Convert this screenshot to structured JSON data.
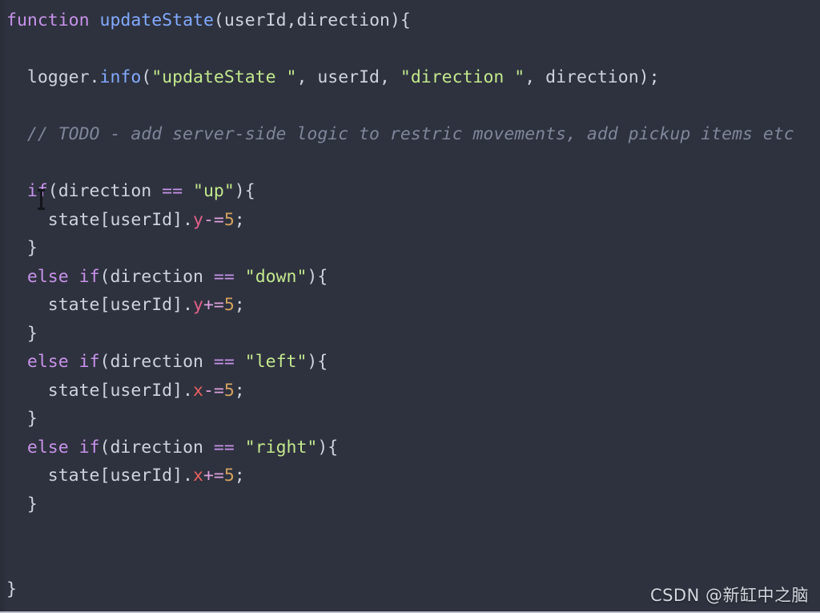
{
  "editor": {
    "background_color": "#2e323e",
    "font_size_px": 21.5,
    "theme_name": "dark",
    "language": "javascript"
  },
  "colors": {
    "background": "#2e323e",
    "gutter_edge": "#2a2e39",
    "keyword": "#c792ea",
    "function_name": "#82aaff",
    "string": "#c3e88d",
    "plain_text": "#cdd2dd",
    "comment": "#7f869a",
    "property_y": "#e25f8a",
    "property_x": "#e8605f",
    "operator": "#dda0dd",
    "number": "#d4a15f",
    "watermark": "#d3d7de",
    "mouse_caret": "#14161c"
  },
  "code": {
    "lines": [
      {
        "index": 1,
        "tokens": [
          {
            "text": "function",
            "kind": "keyword"
          },
          {
            "text": " ",
            "kind": "plain"
          },
          {
            "text": "updateState",
            "kind": "function_name"
          },
          {
            "text": "(userId,direction){",
            "kind": "plain"
          }
        ]
      },
      {
        "index": 2,
        "tokens": []
      },
      {
        "index": 3,
        "tokens": [
          {
            "text": "  logger.",
            "kind": "plain"
          },
          {
            "text": "info",
            "kind": "function_name"
          },
          {
            "text": "(",
            "kind": "plain"
          },
          {
            "text": "\"updateState \"",
            "kind": "string"
          },
          {
            "text": ", userId, ",
            "kind": "plain"
          },
          {
            "text": "\"direction \"",
            "kind": "string"
          },
          {
            "text": ", direction);",
            "kind": "plain"
          }
        ]
      },
      {
        "index": 4,
        "tokens": []
      },
      {
        "index": 5,
        "tokens": [
          {
            "text": "  // TODO - add server-side logic to restric movements, add pickup items etc",
            "kind": "comment"
          }
        ]
      },
      {
        "index": 6,
        "tokens": []
      },
      {
        "index": 7,
        "tokens": [
          {
            "text": "  ",
            "kind": "plain"
          },
          {
            "text": "if",
            "kind": "keyword"
          },
          {
            "text": "(direction ",
            "kind": "plain"
          },
          {
            "text": "==",
            "kind": "keyword"
          },
          {
            "text": " ",
            "kind": "plain"
          },
          {
            "text": "\"up\"",
            "kind": "string"
          },
          {
            "text": "){",
            "kind": "plain"
          }
        ]
      },
      {
        "index": 8,
        "tokens": [
          {
            "text": "    state[userId].",
            "kind": "plain"
          },
          {
            "text": "y",
            "kind": "property_y"
          },
          {
            "text": "-=",
            "kind": "operator"
          },
          {
            "text": "5",
            "kind": "number"
          },
          {
            "text": ";",
            "kind": "plain"
          }
        ]
      },
      {
        "index": 9,
        "tokens": [
          {
            "text": "  }",
            "kind": "plain"
          }
        ]
      },
      {
        "index": 10,
        "tokens": [
          {
            "text": "  ",
            "kind": "plain"
          },
          {
            "text": "else",
            "kind": "keyword"
          },
          {
            "text": " ",
            "kind": "plain"
          },
          {
            "text": "if",
            "kind": "keyword"
          },
          {
            "text": "(direction ",
            "kind": "plain"
          },
          {
            "text": "==",
            "kind": "keyword"
          },
          {
            "text": " ",
            "kind": "plain"
          },
          {
            "text": "\"down\"",
            "kind": "string"
          },
          {
            "text": "){",
            "kind": "plain"
          }
        ]
      },
      {
        "index": 11,
        "tokens": [
          {
            "text": "    state[userId].",
            "kind": "plain"
          },
          {
            "text": "y",
            "kind": "property_y"
          },
          {
            "text": "+=",
            "kind": "operator"
          },
          {
            "text": "5",
            "kind": "number"
          },
          {
            "text": ";",
            "kind": "plain"
          }
        ]
      },
      {
        "index": 12,
        "tokens": [
          {
            "text": "  }",
            "kind": "plain"
          }
        ]
      },
      {
        "index": 13,
        "tokens": [
          {
            "text": "  ",
            "kind": "plain"
          },
          {
            "text": "else",
            "kind": "keyword"
          },
          {
            "text": " ",
            "kind": "plain"
          },
          {
            "text": "if",
            "kind": "keyword"
          },
          {
            "text": "(direction ",
            "kind": "plain"
          },
          {
            "text": "==",
            "kind": "keyword"
          },
          {
            "text": " ",
            "kind": "plain"
          },
          {
            "text": "\"left\"",
            "kind": "string"
          },
          {
            "text": "){",
            "kind": "plain"
          }
        ]
      },
      {
        "index": 14,
        "tokens": [
          {
            "text": "    state[userId].",
            "kind": "plain"
          },
          {
            "text": "x",
            "kind": "property_x"
          },
          {
            "text": "-=",
            "kind": "operator"
          },
          {
            "text": "5",
            "kind": "number"
          },
          {
            "text": ";",
            "kind": "plain"
          }
        ]
      },
      {
        "index": 15,
        "tokens": [
          {
            "text": "  }",
            "kind": "plain"
          }
        ]
      },
      {
        "index": 16,
        "tokens": [
          {
            "text": "  ",
            "kind": "plain"
          },
          {
            "text": "else",
            "kind": "keyword"
          },
          {
            "text": " ",
            "kind": "plain"
          },
          {
            "text": "if",
            "kind": "keyword"
          },
          {
            "text": "(direction ",
            "kind": "plain"
          },
          {
            "text": "==",
            "kind": "keyword"
          },
          {
            "text": " ",
            "kind": "plain"
          },
          {
            "text": "\"right\"",
            "kind": "string"
          },
          {
            "text": "){",
            "kind": "plain"
          }
        ]
      },
      {
        "index": 17,
        "tokens": [
          {
            "text": "    state[userId].",
            "kind": "plain"
          },
          {
            "text": "x",
            "kind": "property_x"
          },
          {
            "text": "+=",
            "kind": "operator"
          },
          {
            "text": "5",
            "kind": "number"
          },
          {
            "text": ";",
            "kind": "plain"
          }
        ]
      },
      {
        "index": 18,
        "tokens": [
          {
            "text": "  }",
            "kind": "plain"
          }
        ]
      },
      {
        "index": 19,
        "tokens": []
      },
      {
        "index": 20,
        "tokens": []
      },
      {
        "index": 21,
        "tokens": [
          {
            "text": "}",
            "kind": "plain"
          }
        ]
      }
    ]
  },
  "watermark": {
    "text": "CSDN @新缸中之脑"
  }
}
